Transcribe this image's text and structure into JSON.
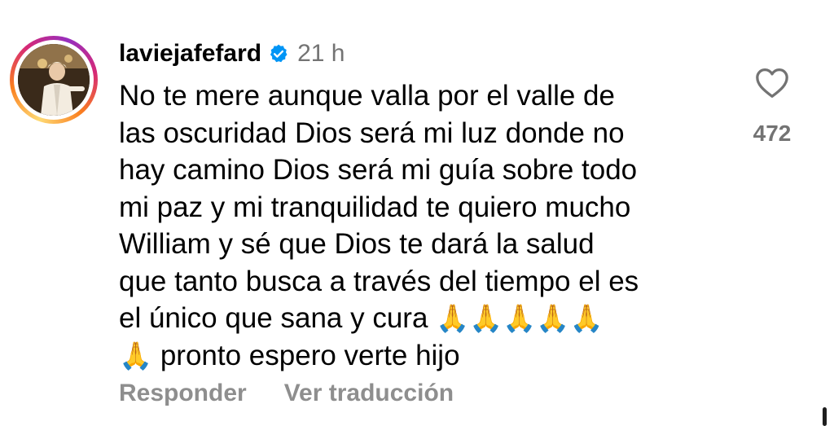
{
  "comment": {
    "username": "laviejafefard",
    "time": "21 h",
    "verified_icon": "verified-badge-icon",
    "lines": [
      "No te mere aunque valla por el valle de",
      "las oscuridad Dios será mi luz donde no",
      "hay camino Dios será mi guía sobre todo",
      "mi paz y mi tranquilidad te quiero mucho",
      "William y sé que Dios te dará la salud",
      "que tanto busca a través del tiempo el es",
      "el único que sana y cura",
      "pronto espero verte hijo"
    ],
    "emoji_line7": "🙏🙏🙏🙏🙏",
    "emoji_line8": "🙏",
    "like_count": "472",
    "reply_label": "Responder",
    "translate_label": "Ver traducción"
  },
  "colors": {
    "secondary_text": "#737373",
    "action_text": "#8e8e8e",
    "verified_blue": "#0095f6"
  }
}
